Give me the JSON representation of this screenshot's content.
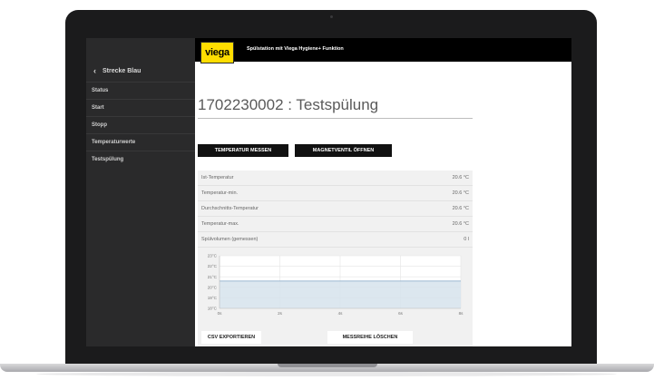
{
  "app": {
    "logo_text": "viega",
    "title": "Spülstation mit Viega Hygiene+ Funktion"
  },
  "sidebar": {
    "back_label": "Strecke Blau",
    "items": [
      "Status",
      "Start",
      "Stopp",
      "Temperaturwerte",
      "Testspülung"
    ]
  },
  "page": {
    "title": "1702230002 : Testspülung"
  },
  "actions": {
    "measure_label": "TEMPERATUR MESSEN",
    "valve_label": "MAGNETVENTIL ÖFFNEN",
    "csv_label": "CSV EXPORTIEREN",
    "clear_label": "MESSREIHE LÖSCHEN"
  },
  "readings": [
    {
      "label": "Ist-Temperatur",
      "value": "20.6 °C"
    },
    {
      "label": "Temperatur-min.",
      "value": "20.6 °C"
    },
    {
      "label": "Durchschnitts-Temperatur",
      "value": "20.6 °C"
    },
    {
      "label": "Temperatur-max.",
      "value": "20.6 °C"
    },
    {
      "label": "Spülvolumen (gemessen)",
      "value": "0 l"
    }
  ],
  "chart_data": {
    "type": "area",
    "x": [
      0,
      8
    ],
    "y": [
      20.6,
      20.6
    ],
    "xticks": [
      "0s",
      "2s",
      "4s",
      "6s",
      "8s"
    ],
    "yticks": [
      "18°C",
      "19°C",
      "20°C",
      "21°C",
      "22°C",
      "23°C"
    ],
    "xlim": [
      0,
      8
    ],
    "ylim": [
      18,
      23
    ],
    "grid": true,
    "colors": {
      "line": "#9bb8d0",
      "fill": "#d6e3ec"
    }
  },
  "colors": {
    "brand_yellow": "#ffdd00",
    "sidebar_bg": "#2a2a2b",
    "topbar_bg": "#000000"
  }
}
